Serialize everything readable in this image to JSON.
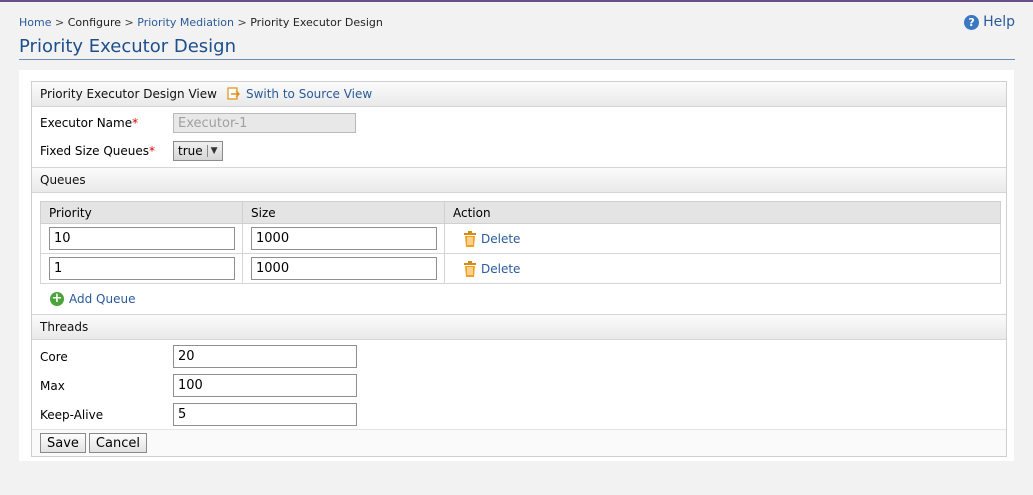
{
  "breadcrumb": {
    "home": "Home",
    "sep": ">",
    "configure": "Configure",
    "priority_mediation": "Priority Mediation",
    "current": "Priority Executor Design"
  },
  "help": {
    "label": "Help",
    "icon": "help-icon"
  },
  "page_title": "Priority Executor Design",
  "design_view": {
    "header": "Priority Executor Design View",
    "switch_link": "Swith to Source View",
    "executor_name_label": "Executor Name",
    "executor_name_value": "Executor-1",
    "fixed_size_label": "Fixed Size Queues",
    "fixed_size_value": "true",
    "required_mark": "*"
  },
  "queues": {
    "header": "Queues",
    "columns": [
      "Priority",
      "Size",
      "Action"
    ],
    "rows": [
      {
        "priority": "10",
        "size": "1000",
        "action": "Delete"
      },
      {
        "priority": "1",
        "size": "1000",
        "action": "Delete"
      }
    ],
    "add_label": "Add Queue"
  },
  "threads": {
    "header": "Threads",
    "core_label": "Core",
    "core_value": "20",
    "max_label": "Max",
    "max_value": "100",
    "keepalive_label": "Keep-Alive",
    "keepalive_value": "5"
  },
  "buttons": {
    "save": "Save",
    "cancel": "Cancel"
  },
  "colors": {
    "link": "#2a5a9a",
    "title": "#1c4f8c",
    "required": "#dd0000",
    "add": "#4aa33b"
  }
}
